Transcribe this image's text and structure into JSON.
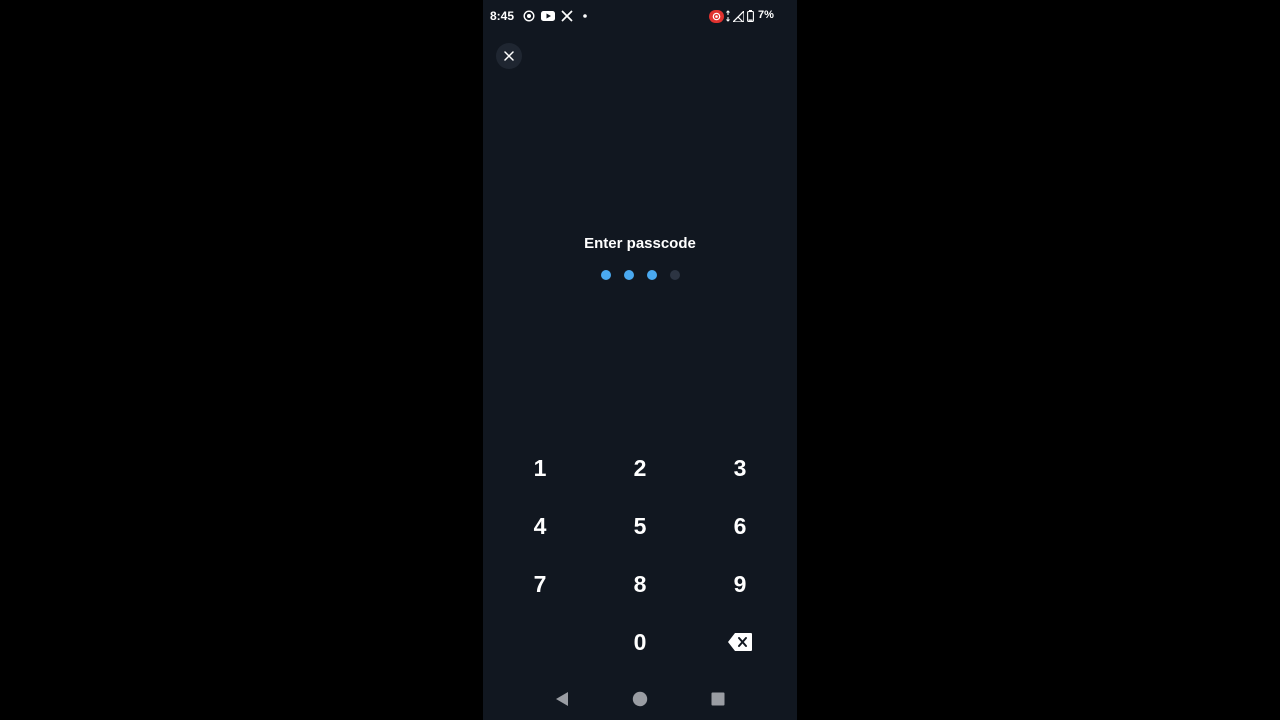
{
  "status_bar": {
    "time": "8:45",
    "battery": "7%",
    "icons": [
      "screen-record-icon",
      "youtube-icon",
      "x-icon",
      "dot-icon",
      "record-badge-icon",
      "data-arrows-icon",
      "signal-icon",
      "battery-icon"
    ]
  },
  "screen": {
    "title": "Enter passcode",
    "passcode": {
      "length": 4,
      "filled": 3,
      "filled_color": "#4aa9f0",
      "empty_color": "#2c3442"
    }
  },
  "keypad": {
    "keys": [
      "1",
      "2",
      "3",
      "4",
      "5",
      "6",
      "7",
      "8",
      "9",
      "0"
    ],
    "backspace_icon": "backspace-icon"
  },
  "colors": {
    "background": "#111720",
    "accent": "#4aa9f0",
    "record_red": "#e0322f"
  },
  "nav": {
    "icons": [
      "back-icon",
      "home-icon",
      "recents-icon"
    ]
  }
}
